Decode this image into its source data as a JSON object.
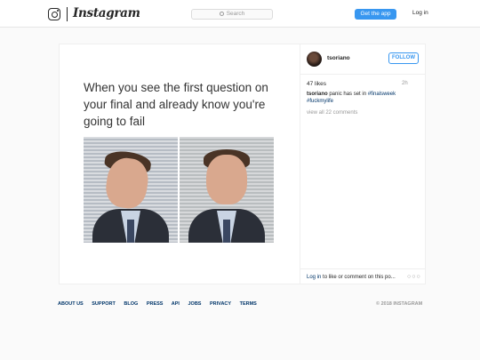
{
  "nav": {
    "logo_text": "Instagram",
    "search_placeholder": "Search",
    "get_app_label": "Get the app",
    "login_label": "Log in"
  },
  "post": {
    "meme_text": "When you see the first question on your final and already know you're going to fail",
    "username": "tsoriano",
    "follow_label": "FOLLOW",
    "likes": "47 likes",
    "time_ago": "2h",
    "caption_user": "tsoriano",
    "caption_text": "panic has set in",
    "hashtag1": "#finalsweek",
    "hashtag2": "#fuckmylife",
    "view_comments": "view all 22 comments",
    "login_link": "Log in",
    "login_rest": "to like or comment on this po...",
    "more_glyph": "○○○"
  },
  "footer": {
    "links": [
      "ABOUT US",
      "SUPPORT",
      "BLOG",
      "PRESS",
      "API",
      "JOBS",
      "PRIVACY",
      "TERMS"
    ],
    "copyright": "© 2018 INSTAGRAM"
  }
}
